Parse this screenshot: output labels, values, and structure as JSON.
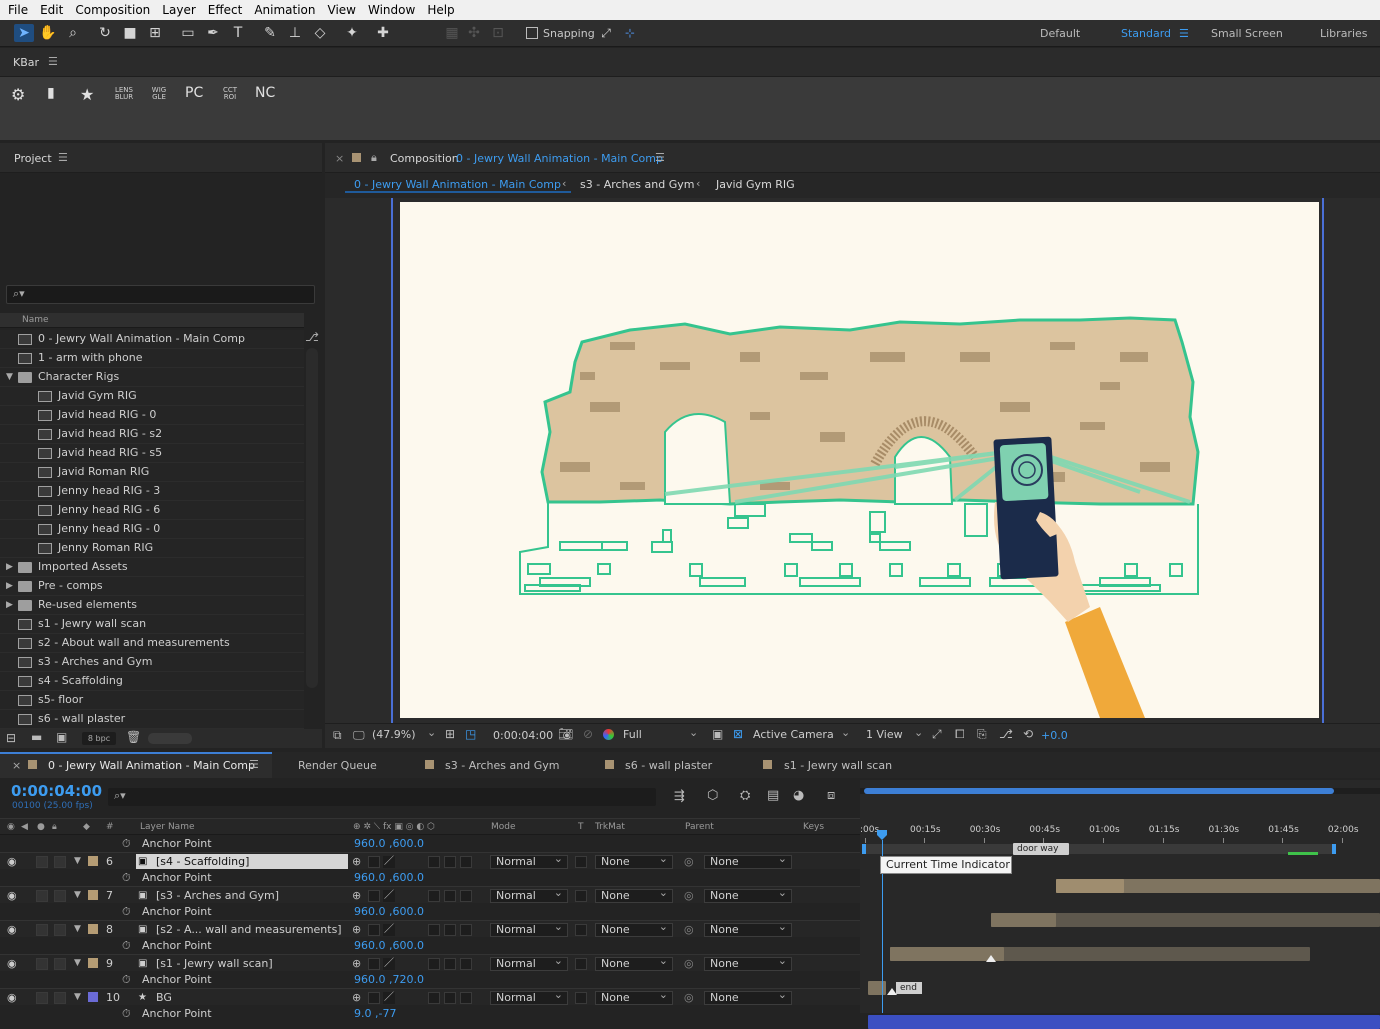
{
  "menu": [
    "File",
    "Edit",
    "Composition",
    "Layer",
    "Effect",
    "Animation",
    "View",
    "Window",
    "Help"
  ],
  "toolbar": {
    "snapping_label": "Snapping",
    "workspaces": [
      "Default",
      "Standard",
      "Small Screen",
      "Libraries"
    ],
    "active_workspace": "Standard"
  },
  "kbar": {
    "title": "KBar",
    "buttons": [
      "LENS BLUR",
      "WIG GLE",
      "PC",
      "CCT ROI",
      "NC"
    ]
  },
  "project": {
    "title": "Project",
    "column_name": "Name",
    "bpc": "8 bpc",
    "items": [
      {
        "name": "0 - Jewry Wall Animation - Main Comp",
        "type": "comp",
        "indent": 0
      },
      {
        "name": "1 - arm with phone",
        "type": "comp",
        "indent": 0
      },
      {
        "name": "Character Rigs",
        "type": "folder-open",
        "indent": 0
      },
      {
        "name": "Javid Gym RIG",
        "type": "comp",
        "indent": 1
      },
      {
        "name": "Javid head RIG - 0",
        "type": "comp",
        "indent": 1
      },
      {
        "name": "Javid head RIG - s2",
        "type": "comp",
        "indent": 1
      },
      {
        "name": "Javid head RIG - s5",
        "type": "comp",
        "indent": 1
      },
      {
        "name": "Javid Roman RIG",
        "type": "comp",
        "indent": 1
      },
      {
        "name": "Jenny head RIG - 3",
        "type": "comp",
        "indent": 1
      },
      {
        "name": "Jenny head RIG - 6",
        "type": "comp",
        "indent": 1
      },
      {
        "name": "Jenny head RIG - 0",
        "type": "comp",
        "indent": 1
      },
      {
        "name": "Jenny Roman RIG",
        "type": "comp",
        "indent": 1
      },
      {
        "name": "Imported Assets",
        "type": "folder",
        "indent": 0
      },
      {
        "name": "Pre - comps",
        "type": "folder",
        "indent": 0
      },
      {
        "name": "Re-used elements",
        "type": "folder",
        "indent": 0
      },
      {
        "name": "s1 - Jewry wall scan",
        "type": "comp",
        "indent": 0
      },
      {
        "name": "s2 - About wall and measurements",
        "type": "comp",
        "indent": 0
      },
      {
        "name": "s3 - Arches and Gym",
        "type": "comp",
        "indent": 0
      },
      {
        "name": "s4 - Scaffolding",
        "type": "comp",
        "indent": 0
      },
      {
        "name": "s5- floor",
        "type": "comp",
        "indent": 0
      },
      {
        "name": "s6 - wall plaster",
        "type": "comp",
        "indent": 0
      }
    ]
  },
  "composition": {
    "panel_prefix": "Composition",
    "title": "0 - Jewry Wall Animation - Main Comp",
    "breadcrumbs": [
      "0 - Jewry Wall Animation - Main Comp",
      "s3 - Arches and Gym",
      "Javid Gym RIG"
    ],
    "zoom": "(47.9%)",
    "timecode": "0:00:04:00",
    "resolution": "Full",
    "camera": "Active Camera",
    "views": "1 View",
    "exposure": "+0.0"
  },
  "timeline": {
    "tabs": [
      "0 - Jewry Wall Animation - Main Comp",
      "Render Queue",
      "s3 - Arches and Gym",
      "s6 - wall plaster",
      "s1 - Jewry wall scan"
    ],
    "timecode": "0:00:04:00",
    "frames": "00100 (25.00 fps)",
    "columns": {
      "layer_name": "Layer Name",
      "mode": "Mode",
      "t": "T",
      "trkmat": "TrkMat",
      "parent": "Parent",
      "keys": "Keys"
    },
    "ruler": [
      ":00s",
      "00:15s",
      "00:30s",
      "00:45s",
      "01:00s",
      "01:15s",
      "01:30s",
      "01:45s",
      "02:00s"
    ],
    "marker_label": "door way",
    "end_marker": "end",
    "tooltip": "Current Time Indicator",
    "anchor_label": "Anchor Point",
    "top_anchor_value": "960.0 ,600.0",
    "layers": [
      {
        "num": "6",
        "name": "[s4 - Scaffolding]",
        "color": "#b59c74",
        "mode": "Normal",
        "trkmat": "None",
        "parent": "None",
        "anchor": "960.0 ,600.0",
        "selected": true
      },
      {
        "num": "7",
        "name": "[s3 - Arches and Gym]",
        "color": "#b59c74",
        "mode": "Normal",
        "trkmat": "None",
        "parent": "None",
        "anchor": "960.0 ,600.0",
        "selected": false
      },
      {
        "num": "8",
        "name": "[s2 - A... wall and measurements]",
        "color": "#b59c74",
        "mode": "Normal",
        "trkmat": "None",
        "parent": "None",
        "anchor": "960.0 ,600.0",
        "selected": false
      },
      {
        "num": "9",
        "name": "[s1 - Jewry wall scan]",
        "color": "#b59c74",
        "mode": "Normal",
        "trkmat": "None",
        "parent": "None",
        "anchor": "960.0 ,720.0",
        "selected": false
      },
      {
        "num": "10",
        "name": "BG",
        "color": "#6b6bd6",
        "mode": "Normal",
        "trkmat": "None",
        "parent": "None",
        "anchor": "9.0 ,-77",
        "selected": false
      }
    ]
  }
}
